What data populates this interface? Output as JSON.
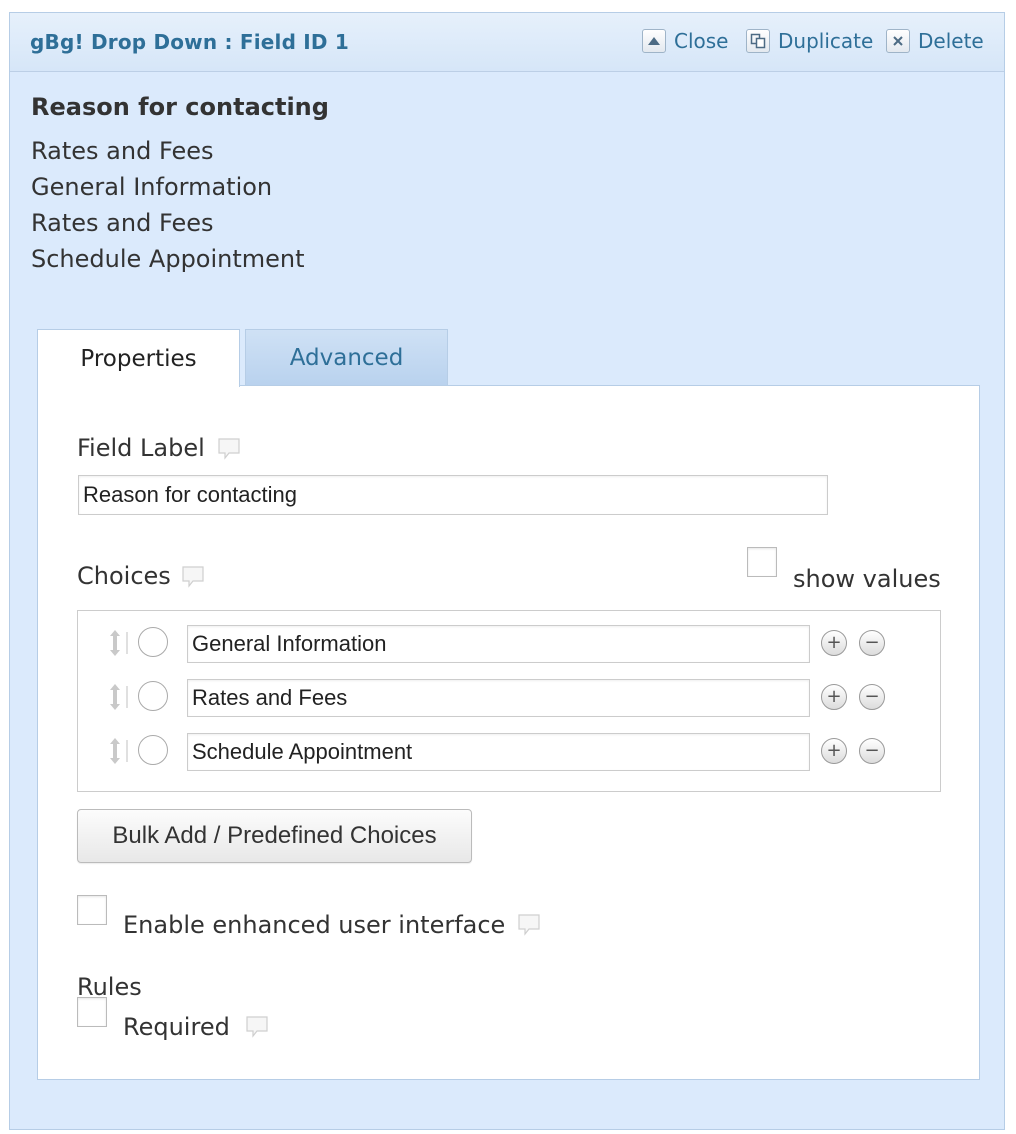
{
  "header": {
    "title": "gBg! Drop Down : Field ID 1",
    "actions": {
      "close": "Close",
      "duplicate": "Duplicate",
      "delete": "Delete"
    }
  },
  "preview": {
    "label": "Reason for contacting",
    "options": [
      "Rates and Fees",
      "General Information",
      "Rates and Fees",
      "Schedule Appointment"
    ]
  },
  "tabs": {
    "properties": "Properties",
    "advanced": "Advanced"
  },
  "properties": {
    "field_label": {
      "label": "Field Label",
      "value": "Reason for contacting"
    },
    "choices": {
      "label": "Choices",
      "show_values_label": "show values",
      "show_values_checked": false,
      "items": [
        "General Information",
        "Rates and Fees",
        "Schedule Appointment"
      ]
    },
    "bulk_add_button": "Bulk Add / Predefined Choices",
    "enhanced_ui": {
      "label": "Enable enhanced user interface",
      "checked": false
    },
    "rules": {
      "heading": "Rules",
      "required_label": "Required",
      "required_checked": false
    }
  },
  "icons": {
    "close": "caret-up-icon",
    "duplicate": "duplicate-icon",
    "delete": "x-icon",
    "tooltip": "speech-bubble-icon",
    "drag": "updown-arrow-icon",
    "add": "plus-circle-icon",
    "remove": "minus-circle-icon"
  },
  "colors": {
    "panel_background": "#dbeafc",
    "title_text": "#2e6f98",
    "border": "#b6cde6"
  }
}
